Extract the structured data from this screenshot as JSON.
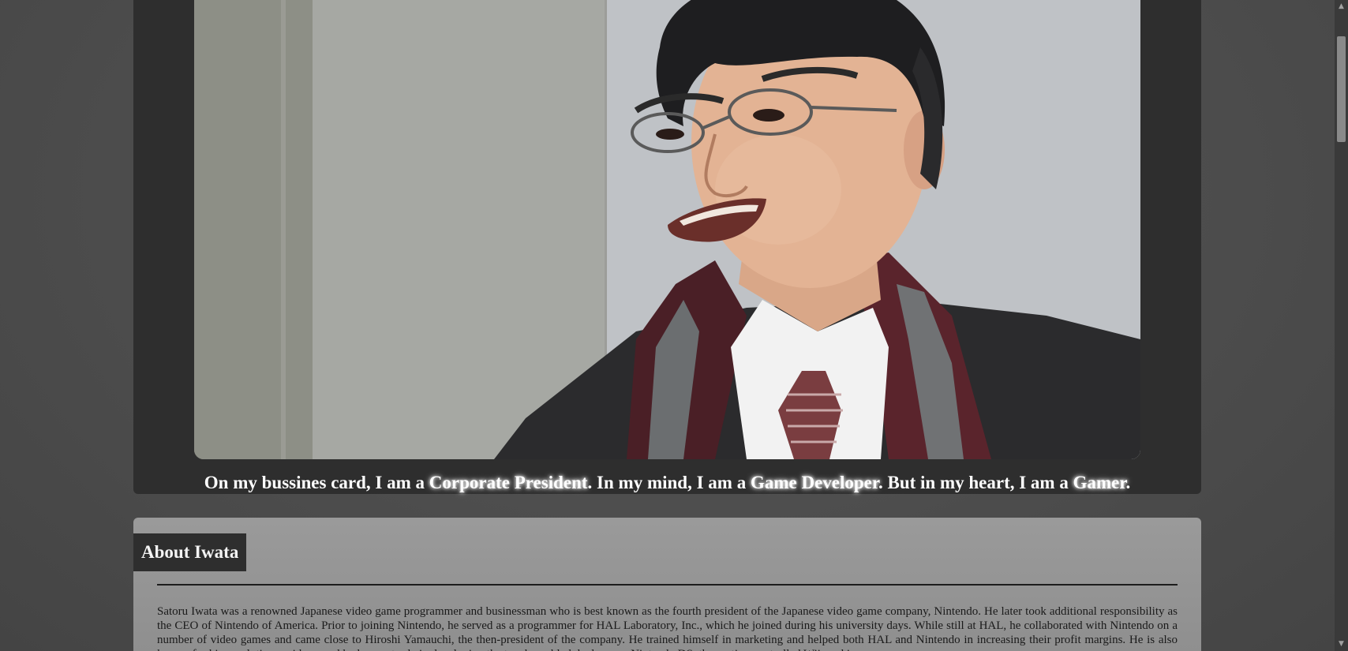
{
  "hero": {
    "caption_parts": [
      "On my bussines card, I am a ",
      "Corporate President",
      ". In my mind, I am a ",
      "Game Developer",
      ". But in my heart, I am a ",
      "Gamer",
      "."
    ]
  },
  "about": {
    "heading": "About Iwata",
    "paragraph": "Satoru Iwata was a renowned Japanese video game programmer and businessman who is best known as the fourth president of the Japanese video game company, Nintendo. He later took additional responsibility as the CEO of Nintendo of America. Prior to joining Nintendo, he served as a programmer for HAL Laboratory, Inc., which he joined during his university days. While still at HAL, he collaborated with Nintendo on a number of video games and came close to Hiroshi Yamauchi, the then-president of the company. He trained himself in marketing and helped both HAL and Nintendo in increasing their profit margins. He is also known for his revolutionary ideas, and had a great role in developing the touch-enabled dual screen Nintendo DS, the motion controlled Wii, and in"
  },
  "scrollbar": {
    "up_icon": "triangle-up",
    "down_icon": "triangle-down"
  }
}
